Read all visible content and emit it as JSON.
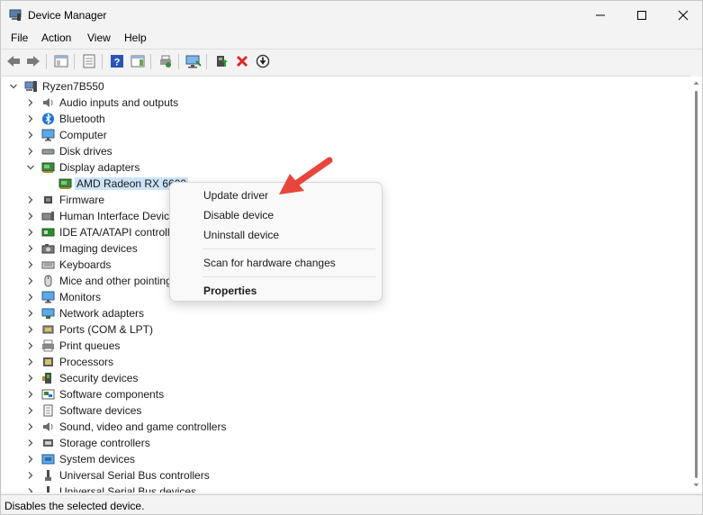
{
  "window": {
    "title": "Device Manager"
  },
  "menu": [
    "File",
    "Action",
    "View",
    "Help"
  ],
  "tree": {
    "root": "Ryzen7B550",
    "items": [
      {
        "label": "Audio inputs and outputs",
        "icon": "speaker-icon",
        "expanded": false
      },
      {
        "label": "Bluetooth",
        "icon": "bluetooth-icon",
        "expanded": false
      },
      {
        "label": "Computer",
        "icon": "monitor-icon",
        "expanded": false
      },
      {
        "label": "Disk drives",
        "icon": "disk-icon",
        "expanded": false
      },
      {
        "label": "Display adapters",
        "icon": "display-adapter-icon",
        "expanded": true
      },
      {
        "label": "AMD Radeon RX 6600",
        "icon": "display-adapter-icon",
        "child": true,
        "selected": true
      },
      {
        "label": "Firmware",
        "icon": "chip-icon",
        "expanded": false
      },
      {
        "label": "Human Interface Devices",
        "icon": "hid-icon",
        "expanded": false
      },
      {
        "label": "IDE ATA/ATAPI controllers",
        "icon": "controller-icon",
        "expanded": false
      },
      {
        "label": "Imaging devices",
        "icon": "camera-icon",
        "expanded": false
      },
      {
        "label": "Keyboards",
        "icon": "keyboard-icon",
        "expanded": false
      },
      {
        "label": "Mice and other pointing devices",
        "icon": "mouse-icon",
        "expanded": false
      },
      {
        "label": "Monitors",
        "icon": "monitor-icon",
        "expanded": false
      },
      {
        "label": "Network adapters",
        "icon": "network-icon",
        "expanded": false
      },
      {
        "label": "Ports (COM & LPT)",
        "icon": "port-icon",
        "expanded": false
      },
      {
        "label": "Print queues",
        "icon": "printer-icon",
        "expanded": false
      },
      {
        "label": "Processors",
        "icon": "processor-icon",
        "expanded": false
      },
      {
        "label": "Security devices",
        "icon": "security-icon",
        "expanded": false
      },
      {
        "label": "Software components",
        "icon": "software-component-icon",
        "expanded": false
      },
      {
        "label": "Software devices",
        "icon": "software-device-icon",
        "expanded": false
      },
      {
        "label": "Sound, video and game controllers",
        "icon": "speaker-icon",
        "expanded": false
      },
      {
        "label": "Storage controllers",
        "icon": "storage-icon",
        "expanded": false
      },
      {
        "label": "System devices",
        "icon": "system-icon",
        "expanded": false
      },
      {
        "label": "Universal Serial Bus controllers",
        "icon": "usb-icon",
        "expanded": false
      },
      {
        "label": "Universal Serial Bus devices",
        "icon": "usb-icon",
        "expanded": false
      }
    ]
  },
  "context_menu": {
    "update_driver": "Update driver",
    "disable_device": "Disable device",
    "uninstall_device": "Uninstall device",
    "scan_hardware": "Scan for hardware changes",
    "properties": "Properties"
  },
  "status": {
    "text": "Disables the selected device."
  },
  "colors": {
    "accent": "#0078d4",
    "selection": "#cce4f7",
    "arrow": "#e8453c",
    "toolbar_red": "#d92b2b"
  }
}
